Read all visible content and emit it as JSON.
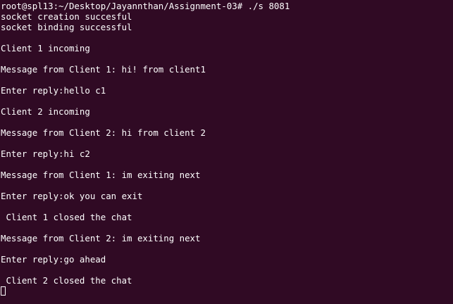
{
  "terminal": {
    "lines": [
      "root@spl13:~/Desktop/Jayannthan/Assignment-03# ./s 8081",
      "socket creation succesful",
      "socket binding successful",
      "",
      "Client 1 incoming",
      "",
      "Message from Client 1: hi! from client1",
      "",
      "Enter reply:hello c1",
      "",
      "Client 2 incoming",
      "",
      "Message from Client 2: hi from client 2",
      "",
      "Enter reply:hi c2",
      "",
      "Message from Client 1: im exiting next",
      "",
      "Enter reply:ok you can exit",
      "",
      " Client 1 closed the chat",
      "",
      "Message from Client 2: im exiting next",
      "",
      "Enter reply:go ahead",
      "",
      " Client 2 closed the chat",
      ""
    ],
    "colors": {
      "background": "#300a24",
      "foreground": "#ffffff"
    }
  }
}
